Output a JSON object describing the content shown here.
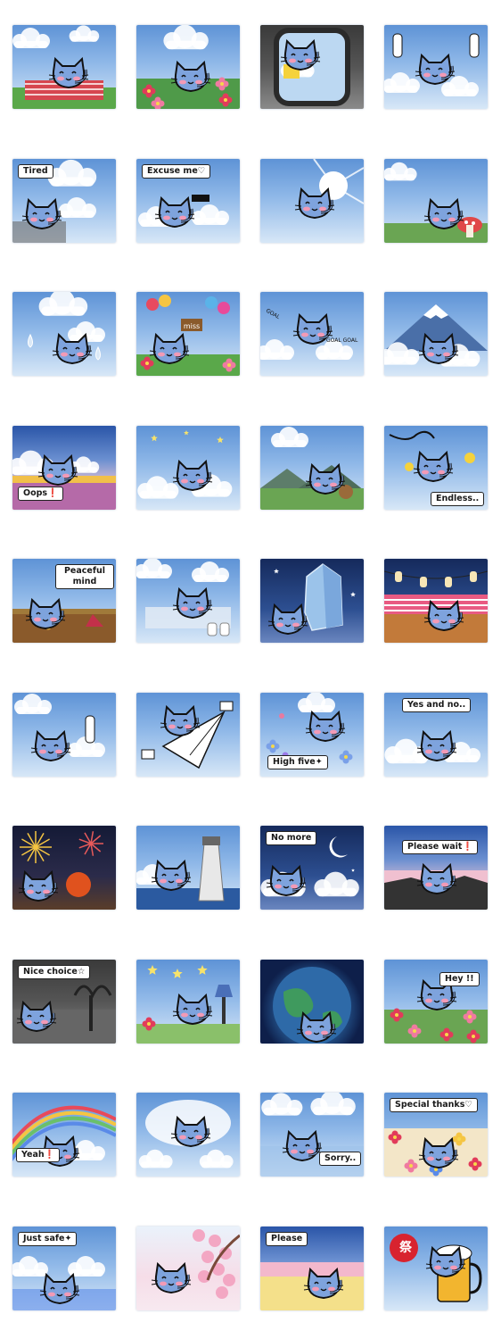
{
  "stickers": [
    {
      "scene": "picnic",
      "theme": "sky",
      "caption": ""
    },
    {
      "scene": "flowers",
      "theme": "sky",
      "caption": ""
    },
    {
      "scene": "window",
      "theme": "dark",
      "caption": ""
    },
    {
      "scene": "shout",
      "theme": "sky",
      "caption": ""
    },
    {
      "scene": "tired",
      "theme": "sky",
      "caption": "Tired"
    },
    {
      "scene": "excuse",
      "theme": "sky",
      "caption": "Excuse me♡"
    },
    {
      "scene": "sunburst",
      "theme": "sky",
      "caption": ""
    },
    {
      "scene": "mushroom",
      "theme": "sky",
      "caption": ""
    },
    {
      "scene": "drops",
      "theme": "sky",
      "caption": ""
    },
    {
      "scene": "balloons",
      "theme": "sky",
      "caption": ""
    },
    {
      "scene": "goal",
      "theme": "sky",
      "caption": ""
    },
    {
      "scene": "fuji",
      "theme": "sky",
      "caption": ""
    },
    {
      "scene": "oops",
      "theme": "sunset",
      "caption": "Oops❗"
    },
    {
      "scene": "stars",
      "theme": "sky",
      "caption": ""
    },
    {
      "scene": "mountains",
      "theme": "sky",
      "caption": ""
    },
    {
      "scene": "endless",
      "theme": "sky",
      "caption": "Endless.."
    },
    {
      "scene": "peaceful",
      "theme": "sky",
      "caption": "Peaceful mind"
    },
    {
      "scene": "paper",
      "theme": "sky",
      "caption": ""
    },
    {
      "scene": "crystal",
      "theme": "night",
      "caption": ""
    },
    {
      "scene": "festival",
      "theme": "night",
      "caption": ""
    },
    {
      "scene": "sign",
      "theme": "sky",
      "caption": ""
    },
    {
      "scene": "plane",
      "theme": "sky",
      "caption": ""
    },
    {
      "scene": "highfive",
      "theme": "sky",
      "caption": "High five✦"
    },
    {
      "scene": "yesno",
      "theme": "sky",
      "caption": "Yes and no.."
    },
    {
      "scene": "fireworks",
      "theme": "fire",
      "caption": ""
    },
    {
      "scene": "lighthouse",
      "theme": "sky",
      "caption": ""
    },
    {
      "scene": "nomore",
      "theme": "night",
      "caption": "No more"
    },
    {
      "scene": "wait",
      "theme": "sunset",
      "caption": "Please wait❗"
    },
    {
      "scene": "nicechoice",
      "theme": "dark",
      "caption": "Nice choice☆"
    },
    {
      "scene": "starlamp",
      "theme": "sky",
      "caption": ""
    },
    {
      "scene": "earth",
      "theme": "earth",
      "caption": ""
    },
    {
      "scene": "hey",
      "theme": "sky",
      "caption": "Hey !!"
    },
    {
      "scene": "rainbow",
      "theme": "sky",
      "caption": "Yeah❗"
    },
    {
      "scene": "cloud",
      "theme": "sky",
      "caption": ""
    },
    {
      "scene": "sorry",
      "theme": "sky",
      "caption": "Sorry.."
    },
    {
      "scene": "thanks",
      "theme": "sky",
      "caption": "Special thanks♡"
    },
    {
      "scene": "justsafe",
      "theme": "sky",
      "caption": "Just safe✦"
    },
    {
      "scene": "sakura",
      "theme": "sakura",
      "caption": ""
    },
    {
      "scene": "please",
      "theme": "sunset",
      "caption": "Please"
    },
    {
      "scene": "beer",
      "theme": "sky",
      "caption": "祭"
    }
  ]
}
